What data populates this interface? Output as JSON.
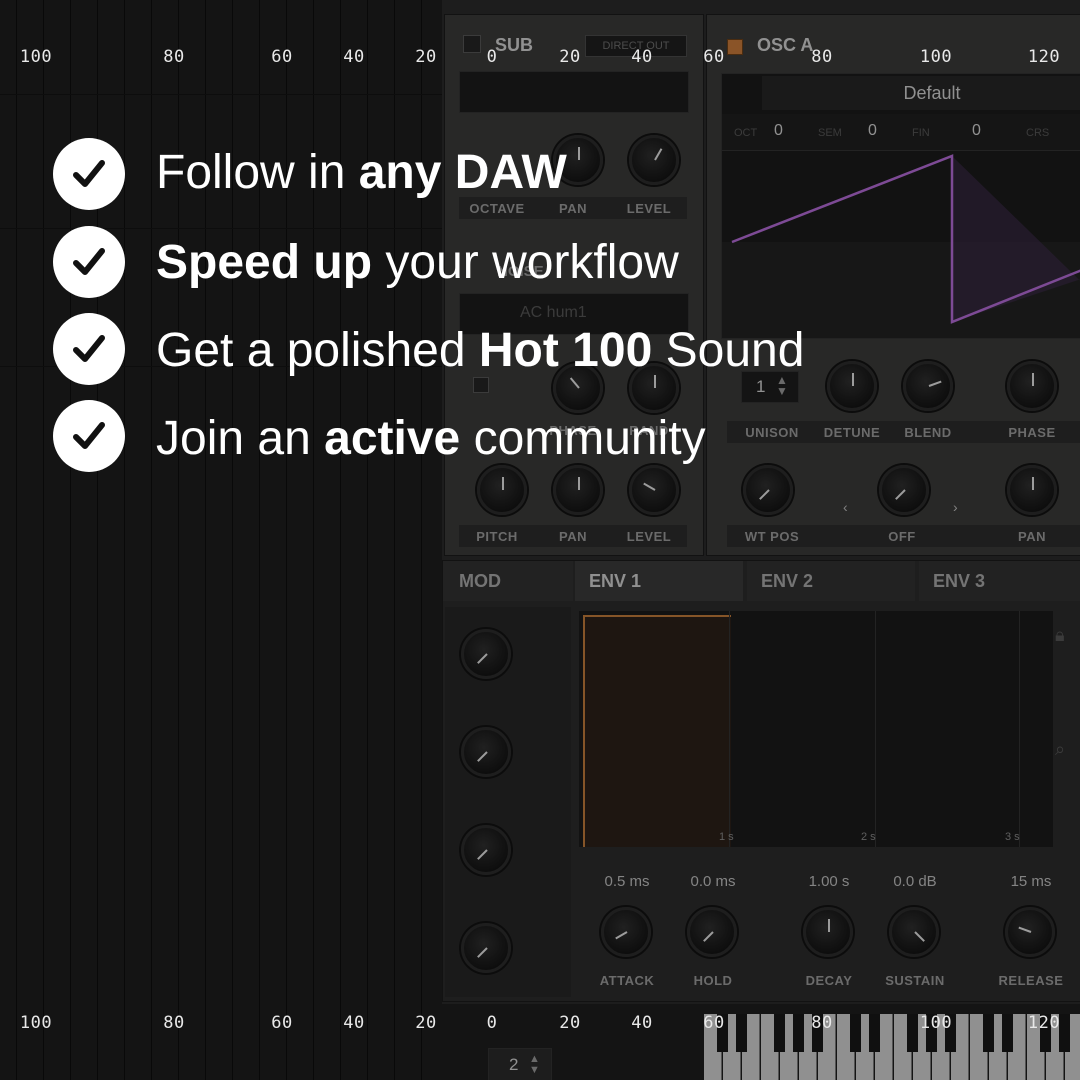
{
  "ruler": [
    "100",
    "80",
    "60",
    "40",
    "20",
    "0",
    "20",
    "40",
    "60",
    "80",
    "100",
    "120"
  ],
  "features": [
    {
      "pre": "Follow in ",
      "bold": "any DAW",
      "post": ""
    },
    {
      "pre": "",
      "bold": "Speed up",
      "post": " your workflow"
    },
    {
      "pre": "Get a polished ",
      "bold": "Hot 100",
      "post": " Sound"
    },
    {
      "pre": "Join an ",
      "bold": "active",
      "post": " community"
    }
  ],
  "sub": {
    "title": "SUB",
    "direct_out": "DIRECT OUT",
    "knobs_row1": [
      "OCTAVE",
      "PAN",
      "LEVEL"
    ],
    "knobs_row2": [
      "PHASE",
      "RAND"
    ],
    "knobs_row3": [
      "PITCH",
      "PAN",
      "LEVEL"
    ],
    "noise_preset": "AC hum1",
    "noise_title": "NOISE"
  },
  "osc_a": {
    "title": "OSC A",
    "preset": "Default",
    "octave_label": "OCT",
    "octave_value": "0",
    "semi_label": "SEM",
    "semi_value": "0",
    "fine_label": "FIN",
    "fine_value": "0",
    "coarse_label": "CRS",
    "unison_value": "1",
    "knobs_row1": [
      "UNISON",
      "DETUNE",
      "BLEND",
      "PHASE"
    ],
    "knobs_row2": [
      "WT POS",
      "OFF",
      "PAN"
    ],
    "wave_color": "#b46bd6"
  },
  "mod_tabs": [
    "MOD",
    "ENV 1",
    "ENV 2",
    "ENV 3"
  ],
  "envelope": {
    "time_marks": [
      "1 s",
      "2 s",
      "3 s"
    ],
    "params": [
      {
        "label": "ATTACK",
        "value": "0.5 ms"
      },
      {
        "label": "HOLD",
        "value": "0.0 ms"
      },
      {
        "label": "DECAY",
        "value": "1.00 s"
      },
      {
        "label": "SUSTAIN",
        "value": "0.0 dB"
      },
      {
        "label": "RELEASE",
        "value": "15 ms"
      }
    ]
  },
  "keyboard": {
    "octave_value": "2"
  }
}
